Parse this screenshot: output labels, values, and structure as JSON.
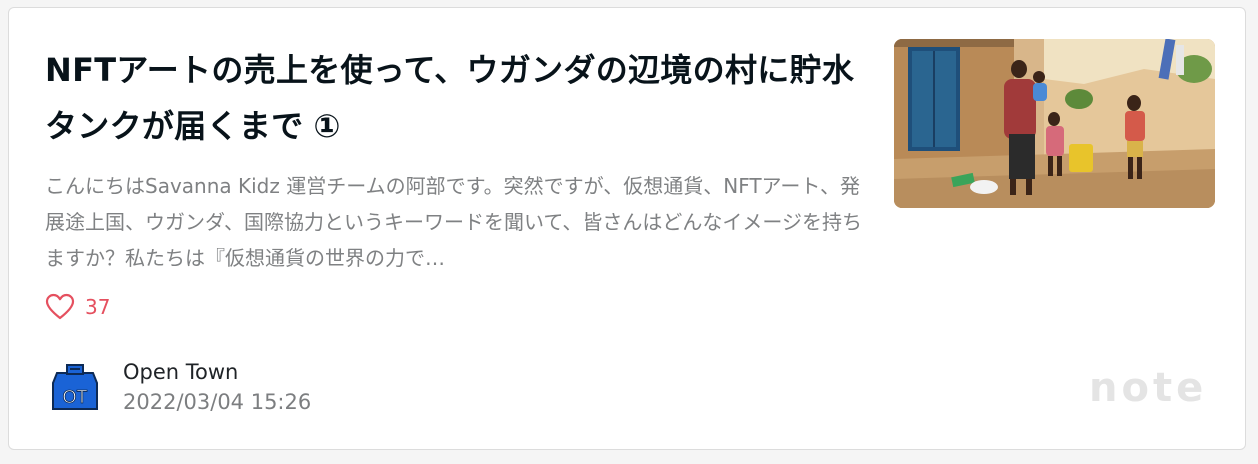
{
  "article": {
    "title": "NFTアートの売上を使って、ウガンダの辺境の村に貯水タンクが届くまで",
    "title_badge": "①",
    "excerpt": "こんにちはSavanna Kidz 運営チームの阿部です。突然ですが、仮想通貨、NFTアート、発展途上国、ウガンダ、国際協力というキーワードを聞いて、皆さんはどんなイメージを持ちますか？私たちは『仮想通貨の世界の力で…",
    "likes": "37",
    "thumbnail_icon": "photo-thumbnail",
    "author": {
      "name": "Open Town",
      "avatar_text": "OT",
      "date": "2022/03/04 15:26"
    }
  },
  "brand": {
    "logo_text": "note"
  },
  "colors": {
    "like": "#e5505f",
    "title": "#08131a",
    "excerpt": "#7f8183",
    "avatar": "#1a63d6"
  }
}
